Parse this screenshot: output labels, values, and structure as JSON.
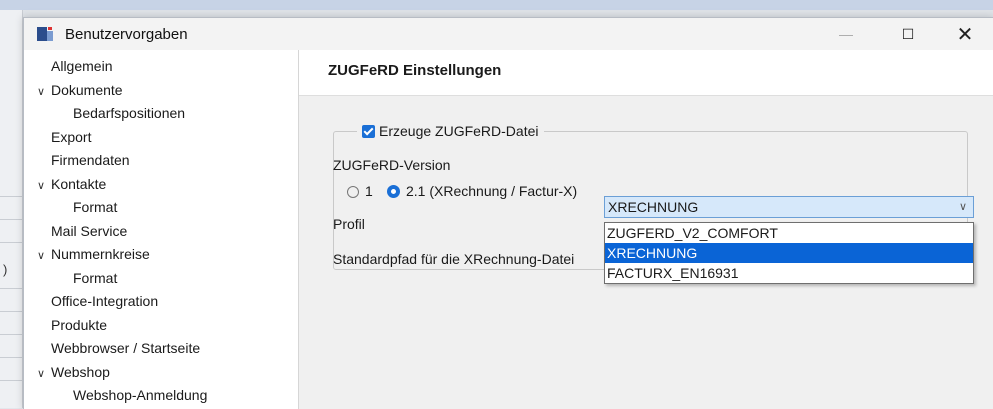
{
  "window": {
    "title": "Benutzervorgaben",
    "minimize_glyph": "—",
    "maximize_glyph": "☐",
    "close_glyph": "✕"
  },
  "background": {
    "paren": ")"
  },
  "nav": {
    "items": [
      {
        "label": "Allgemein",
        "indent": 0,
        "expanded": null
      },
      {
        "label": "Dokumente",
        "indent": 0,
        "expanded": true
      },
      {
        "label": "Bedarfspositionen",
        "indent": 1,
        "expanded": null
      },
      {
        "label": "Export",
        "indent": 0,
        "expanded": null
      },
      {
        "label": "Firmendaten",
        "indent": 0,
        "expanded": null
      },
      {
        "label": "Kontakte",
        "indent": 0,
        "expanded": true
      },
      {
        "label": "Format",
        "indent": 1,
        "expanded": null
      },
      {
        "label": "Mail Service",
        "indent": 0,
        "expanded": null
      },
      {
        "label": "Nummernkreise",
        "indent": 0,
        "expanded": true
      },
      {
        "label": "Format",
        "indent": 1,
        "expanded": null
      },
      {
        "label": "Office-Integration",
        "indent": 0,
        "expanded": null
      },
      {
        "label": "Produkte",
        "indent": 0,
        "expanded": null
      },
      {
        "label": "Webbrowser / Startseite",
        "indent": 0,
        "expanded": null
      },
      {
        "label": "Webshop",
        "indent": 0,
        "expanded": true
      },
      {
        "label": "Webshop-Anmeldung",
        "indent": 1,
        "expanded": null
      }
    ],
    "chevron_glyph": "∨"
  },
  "content": {
    "heading": "ZUGFeRD Einstellungen",
    "generate_checkbox": {
      "label": "Erzeuge ZUGFeRD-Datei",
      "checked": true
    },
    "version_label": "ZUGFeRD-Version",
    "version_options": [
      {
        "label": "1",
        "selected": false
      },
      {
        "label": "2.1 (XRechnung / Factur-X)",
        "selected": true
      }
    ],
    "profile_label": "Profil",
    "profile_value": "XRECHNUNG",
    "profile_arrow": "∨",
    "profile_options": [
      {
        "label": "ZUGFERD_V2_COMFORT",
        "selected": false
      },
      {
        "label": "XRECHNUNG",
        "selected": true
      },
      {
        "label": "FACTURX_EN16931",
        "selected": false
      }
    ],
    "default_path_label": "Standardpfad für die XRechnung-Datei"
  },
  "colors": {
    "accent": "#1a6fd6",
    "selection": "#0a64d6",
    "select_bg": "#d6e8fa"
  }
}
